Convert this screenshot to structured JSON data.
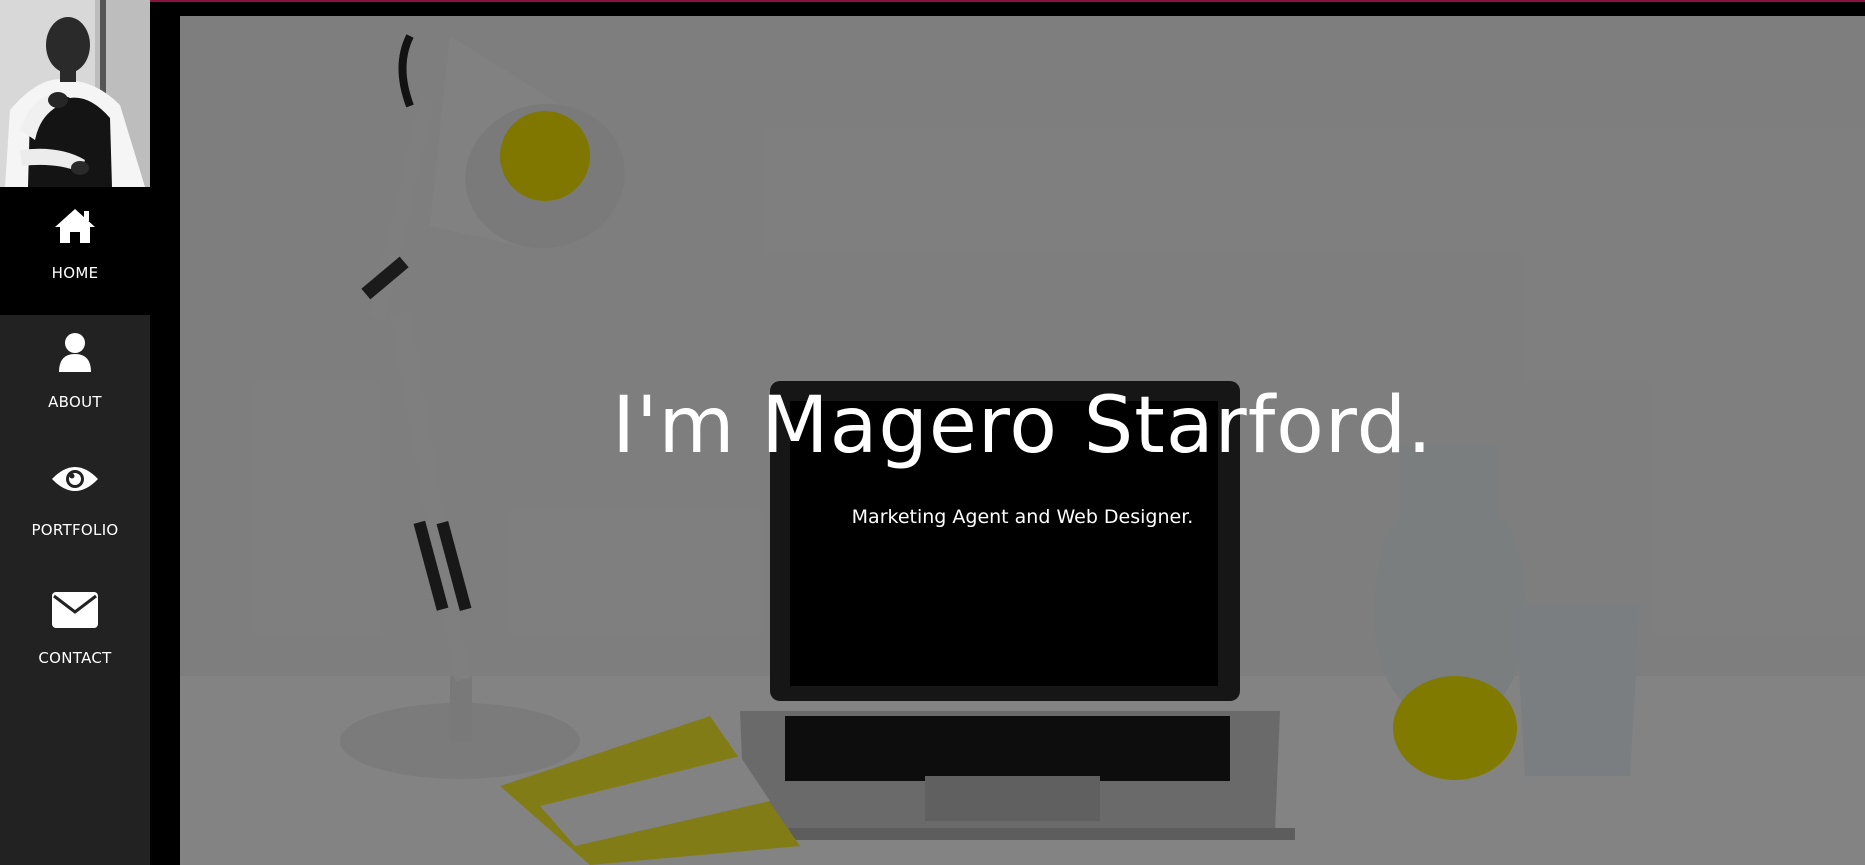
{
  "nav": {
    "items": [
      {
        "label": "HOME",
        "icon": "home-icon",
        "active": true
      },
      {
        "label": "ABOUT",
        "icon": "user-icon",
        "active": false
      },
      {
        "label": "PORTFOLIO",
        "icon": "eye-icon",
        "active": false
      },
      {
        "label": "CONTACT",
        "icon": "envelope-icon",
        "active": false
      }
    ]
  },
  "hero": {
    "title": "I'm Magero Starford.",
    "subtitle": "Marketing Agent and Web Designer."
  },
  "colors": {
    "sidebar": "#222222",
    "active_nav": "#000000",
    "accent_stripe": "#8b1140",
    "text": "#ffffff"
  }
}
